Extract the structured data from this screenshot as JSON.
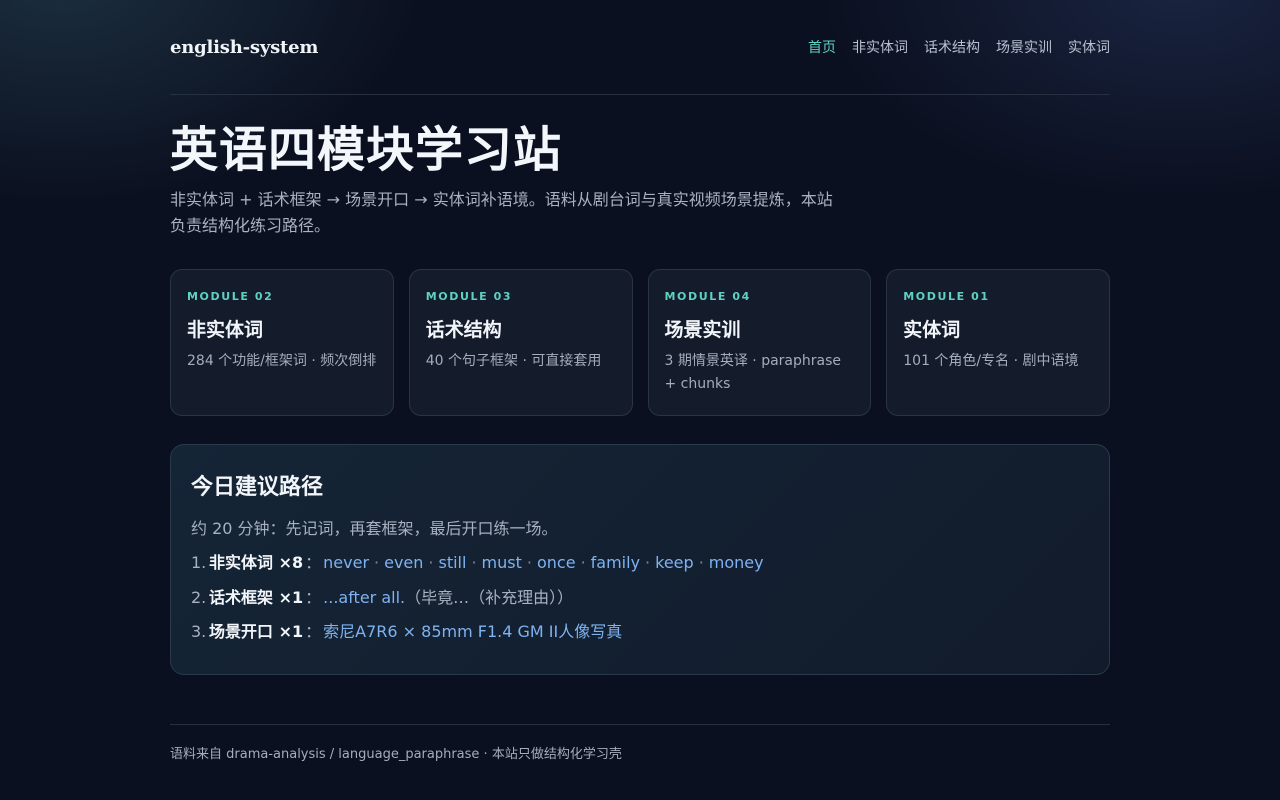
{
  "header": {
    "brand": "english-system",
    "nav": [
      {
        "label": "首页",
        "active": true
      },
      {
        "label": "非实体词",
        "active": false
      },
      {
        "label": "话术结构",
        "active": false
      },
      {
        "label": "场景实训",
        "active": false
      },
      {
        "label": "实体词",
        "active": false
      }
    ]
  },
  "hero": {
    "title": "英语四模块学习站",
    "subtitle": "非实体词 + 话术框架 → 场景开口 → 实体词补语境。语料从剧台词与真实视频场景提炼，本站负责结构化练习路径。"
  },
  "cards": [
    {
      "tag": "MODULE 02",
      "title": "非实体词",
      "desc": "284 个功能/框架词 · 频次倒排"
    },
    {
      "tag": "MODULE 03",
      "title": "话术结构",
      "desc": "40 个句子框架 · 可直接套用"
    },
    {
      "tag": "MODULE 04",
      "title": "场景实训",
      "desc": "3 期情景英译 · paraphrase + chunks"
    },
    {
      "tag": "MODULE 01",
      "title": "实体词",
      "desc": "101 个角色/专名 · 剧中语境"
    }
  ],
  "today": {
    "title": "今日建议路径",
    "subtitle": "约 20 分钟：先记词，再套框架，最后开口练一场。",
    "step1": {
      "num": "1.",
      "label": "非实体词 ×8",
      "words": [
        "never",
        "even",
        "still",
        "must",
        "once",
        "family",
        "keep",
        "money"
      ]
    },
    "step2": {
      "num": "2.",
      "label": "话术框架 ×1",
      "link": "...after all.",
      "note": "（毕竟…（补充理由））"
    },
    "step3": {
      "num": "3.",
      "label": "场景开口 ×1",
      "link": "索尼A7R6 × 85mm F1.4 GM II人像写真"
    },
    "colon": "："
  },
  "footer": {
    "text": "语料来自 drama-analysis / language_paraphrase · 本站只做结构化学习壳"
  },
  "colors": {
    "accent": "#5fd1c2",
    "link": "#7fb2f0",
    "background": "#0b1020"
  }
}
